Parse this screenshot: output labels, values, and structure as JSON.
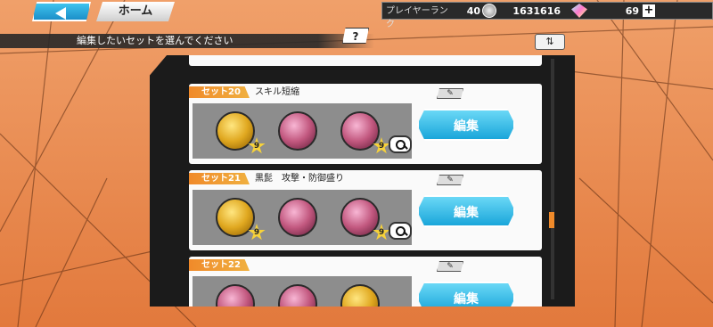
{
  "header": {
    "back_label": "",
    "home_label": "ホーム",
    "rank_label": "プレイヤーランク",
    "rank_value": "40",
    "coins": "1631616",
    "gems": "69",
    "plus_label": "+"
  },
  "instruction": "編集したいセットを選んでください",
  "help_label": "?",
  "sort_label": "⇅",
  "sets": [
    {
      "tag": "セット20",
      "name": "スキル短縮",
      "edit_label": "編集",
      "medals": [
        {
          "color": "gold",
          "star": "9"
        },
        {
          "color": "pink",
          "star": ""
        },
        {
          "color": "pink",
          "star": "9"
        }
      ]
    },
    {
      "tag": "セット21",
      "name": "黒髭　攻撃・防御盛り",
      "edit_label": "編集",
      "medals": [
        {
          "color": "gold",
          "star": "9"
        },
        {
          "color": "pink",
          "star": ""
        },
        {
          "color": "pink",
          "star": "9"
        }
      ]
    },
    {
      "tag": "セット22",
      "name": "",
      "edit_label": "編集",
      "medals": [
        {
          "color": "pink",
          "star": ""
        },
        {
          "color": "pink",
          "star": ""
        },
        {
          "color": "gold",
          "star": ""
        }
      ]
    }
  ],
  "colors": {
    "accent_blue": "#1aa6da",
    "tag_orange": "#f08a2a",
    "background": "#e9894f"
  }
}
